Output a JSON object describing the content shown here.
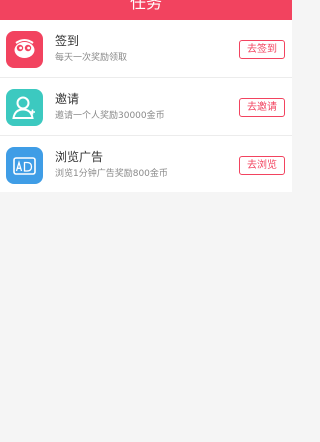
{
  "header": {
    "title": "任务",
    "color": "#f2435f"
  },
  "tasks": [
    {
      "icon": "sign-in-icon",
      "icon_color": "#f2435f",
      "title": "签到",
      "subtitle": "每天一次奖励领取",
      "button_label": "去签到"
    },
    {
      "icon": "invite-user-icon",
      "icon_color": "#3cc9c0",
      "title": "邀请",
      "subtitle": "邀请一个人奖励30000金币",
      "button_label": "去邀请"
    },
    {
      "icon": "ad-icon",
      "icon_color": "#3f9de6",
      "title": "浏览广告",
      "subtitle": "浏览1分钟广告奖励800金币",
      "button_label": "去浏览"
    }
  ]
}
